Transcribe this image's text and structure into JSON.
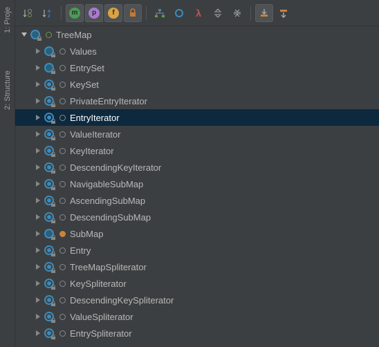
{
  "leftTabs": [
    {
      "id": "project",
      "label": "1: Proje"
    },
    {
      "id": "structure",
      "label": "2: Structure"
    }
  ],
  "toolbar": {
    "sortAlpha": "a↓z",
    "sortVis": "v↓",
    "m": "m",
    "p": "p",
    "f": "f",
    "lock": "lock",
    "iface": "I",
    "circle": "○",
    "lambda": "λ"
  },
  "tree": {
    "root": {
      "label": "TreeMap",
      "expanded": true,
      "iconType": "class",
      "vis": "green",
      "children": [
        {
          "label": "Values",
          "iconType": "class",
          "vis": "grey"
        },
        {
          "label": "EntrySet",
          "iconType": "class",
          "vis": "grey"
        },
        {
          "label": "KeySet",
          "iconType": "abstract",
          "vis": "grey"
        },
        {
          "label": "PrivateEntryIterator",
          "iconType": "abstract",
          "vis": "grey"
        },
        {
          "label": "EntryIterator",
          "iconType": "abstract",
          "vis": "grey",
          "selected": true
        },
        {
          "label": "ValueIterator",
          "iconType": "abstract",
          "vis": "grey"
        },
        {
          "label": "KeyIterator",
          "iconType": "abstract",
          "vis": "grey"
        },
        {
          "label": "DescendingKeyIterator",
          "iconType": "abstract",
          "vis": "grey"
        },
        {
          "label": "NavigableSubMap",
          "iconType": "abstract",
          "vis": "grey"
        },
        {
          "label": "AscendingSubMap",
          "iconType": "abstract",
          "vis": "grey"
        },
        {
          "label": "DescendingSubMap",
          "iconType": "abstract",
          "vis": "grey"
        },
        {
          "label": "SubMap",
          "iconType": "class",
          "vis": "orange"
        },
        {
          "label": "Entry",
          "iconType": "abstract",
          "vis": "grey"
        },
        {
          "label": "TreeMapSpliterator",
          "iconType": "abstract",
          "vis": "grey"
        },
        {
          "label": "KeySpliterator",
          "iconType": "abstract",
          "vis": "grey"
        },
        {
          "label": "DescendingKeySpliterator",
          "iconType": "abstract",
          "vis": "grey"
        },
        {
          "label": "ValueSpliterator",
          "iconType": "abstract",
          "vis": "grey"
        },
        {
          "label": "EntrySpliterator",
          "iconType": "abstract",
          "vis": "grey"
        }
      ]
    }
  },
  "colors": {
    "selection": "#0d293e",
    "bg": "#3c3f41"
  }
}
